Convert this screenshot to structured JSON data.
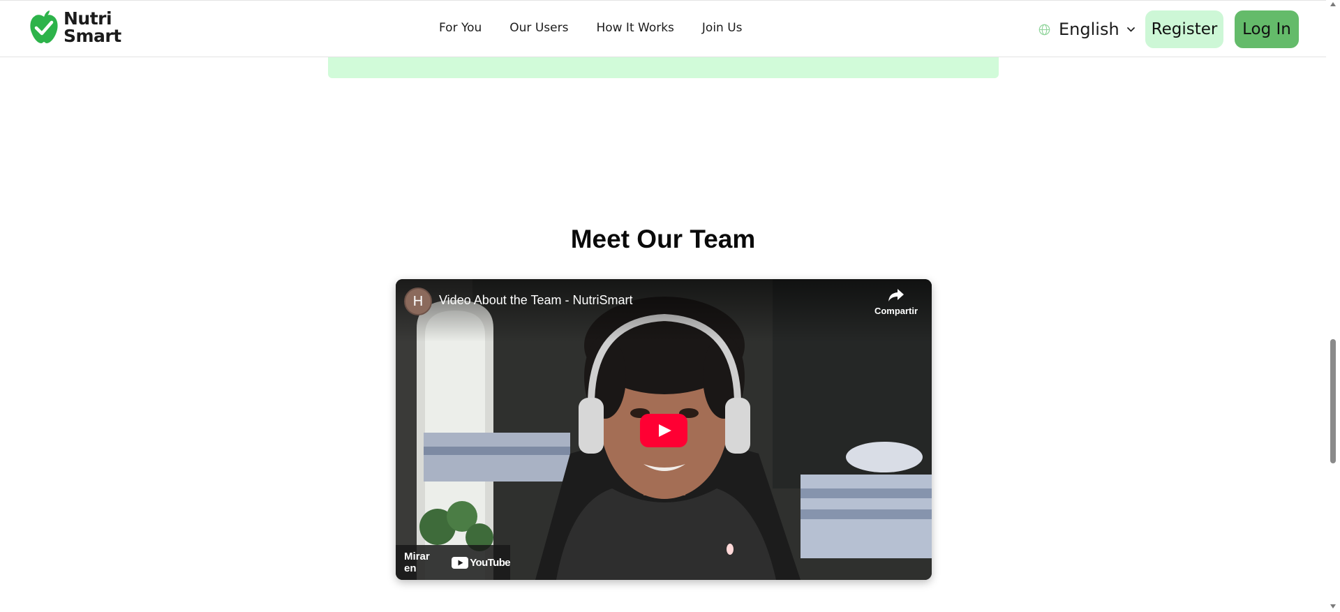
{
  "header": {
    "logo_line1": "Nutri",
    "logo_line2": "Smart",
    "nav": [
      "For You",
      "Our Users",
      "How It Works",
      "Join Us"
    ],
    "language": "English",
    "register_label": "Register",
    "login_label": "Log In"
  },
  "team": {
    "title": "Meet Our Team",
    "video": {
      "channel_initial": "H",
      "title": "Video About the Team - NutriSmart",
      "share_label": "Compartir",
      "watch_on_label": "Mirar en",
      "youtube_wordmark": "YouTube"
    }
  },
  "icons": {
    "logo": "apple-check-icon",
    "language": "globe-icon",
    "dropdown": "chevron-down-icon",
    "share": "share-arrow-icon",
    "play": "play-icon",
    "youtube": "youtube-logo-icon"
  },
  "colors": {
    "brand_green": "#2db34a",
    "register_bg": "#cdf7d6",
    "login_bg": "#64bb6a",
    "panel_bg": "#d1fbd9",
    "youtube_red": "#ff0033"
  }
}
